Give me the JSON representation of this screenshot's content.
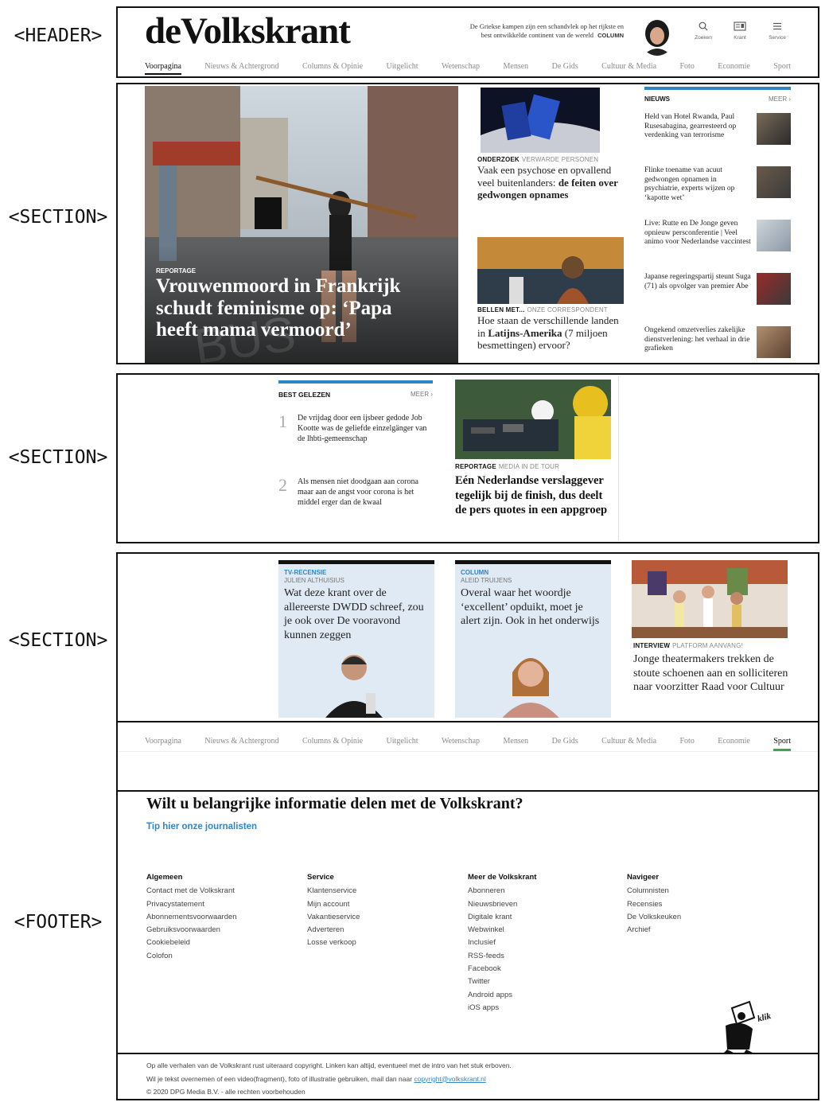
{
  "labels": {
    "header": "<HEADER>",
    "section1": "<SECTION>",
    "section2": "<SECTION>",
    "section3": "<SECTION>",
    "footer": "<FOOTER>"
  },
  "header": {
    "logo": "deVolkskrant",
    "teaser": "De Griekse kampen zijn een schandvlek op het rijkste en best ontwikkelde continent van de wereld",
    "teaser_tag": "COLUMN",
    "search_label": "Zoeken",
    "krant_label": "Krant",
    "service_label": "Service",
    "nav": [
      "Voorpagina",
      "Nieuws & Achtergrond",
      "Columns & Opinie",
      "Uitgelicht",
      "Wetenschap",
      "Mensen",
      "De Gids",
      "Cultuur & Media",
      "Foto",
      "Economie",
      "Sport"
    ],
    "active_nav": "Voorpagina"
  },
  "section1": {
    "hero_kicker": "REPORTAGE",
    "hero_title": "Vrouwenmoord in Frankrijk schudt feminisme op: ‘Papa heeft mama vermoord’",
    "story1_kicker": "ONDERZOEK",
    "story1_sub": "VERWARDE PERSONEN",
    "story1_title": "Vaak een psychose en opvallend veel buitenlanders:",
    "story1_bold": "de feiten over gedwongen opnames",
    "story2_kicker": "BELLEN MET...",
    "story2_sub": "ONZE CORRESPONDENT",
    "story2_title": "Hoe staan de verschillende landen in",
    "story2_bold": "Latijns-Amerika",
    "story2_rest": "(7 miljoen besmettingen) ervoor?",
    "news_label": "NIEUWS",
    "news_more": "MEER ›",
    "news_items": [
      "Held van Hotel Rwanda, Paul Rusesabagina, gearresteerd op verdenking van terrorisme",
      "Flinke toename van acuut gedwongen opnamen in psychiatrie, experts wijzen op ‘kapotte wet’",
      "Live: Rutte en De Jonge geven opnieuw persconferentie | Veel animo voor Nederlandse vaccintest",
      "Japanse regeringspartij steunt Suga (71) als opvolger van premier Abe",
      "Ongekend omzetverlies zakelijke dienstverlening: het verhaal in drie grafieken"
    ]
  },
  "section2": {
    "best_label": "BEST GELEZEN",
    "best_more": "MEER ›",
    "best_items": [
      {
        "num": "1",
        "text": "De vrijdag door een ijsbeer gedode Job Kootte was de geliefde einzelgänger van de lhbti-gemeenschap"
      },
      {
        "num": "2",
        "text": "Als mensen niet doodgaan aan corona maar aan de angst voor corona is het middel erger dan de kwaal"
      }
    ],
    "story_kicker": "REPORTAGE",
    "story_sub": "MEDIA IN DE TOUR",
    "story_title": "Eén Nederlandse verslaggever tegelijk bij de finish, dus deelt de pers quotes in een appgroep"
  },
  "section3": {
    "card1_kicker": "TV-RECENSIE",
    "card1_author": "JULIEN ALTHUISIUS",
    "card1_title": "Wat deze krant over de allereerste DWDD schreef, zou je ook over De vooravond kunnen zeggen",
    "card2_kicker": "COLUMN",
    "card2_author": "ALEID TRUIJENS",
    "card2_title": "Overal waar het woordje ‘excellent’ opduikt, moet je alert zijn. Ook in het onderwijs",
    "card3_kicker": "INTERVIEW",
    "card3_sub": "PLATFORM AANVANG!",
    "card3_title": "Jonge theatermakers trekken de stoute schoenen aan en solliciteren naar voorzitter Raad voor Cultuur"
  },
  "bottom_nav": {
    "items": [
      "Voorpagina",
      "Nieuws & Achtergrond",
      "Columns & Opinie",
      "Uitgelicht",
      "Wetenschap",
      "Mensen",
      "De Gids",
      "Cultuur & Media",
      "Foto",
      "Economie",
      "Sport"
    ],
    "active": "Sport"
  },
  "footer": {
    "headline": "Wilt u belangrijke informatie delen met de Volkskrant?",
    "tip_link": "Tip hier onze journalisten",
    "columns": [
      {
        "title": "Algemeen",
        "links": [
          "Contact met de Volkskrant",
          "Privacystatement",
          "Abonnementsvoorwaarden",
          "Gebruiksvoorwaarden",
          "Cookiebeleid",
          "Colofon"
        ]
      },
      {
        "title": "Service",
        "links": [
          "Klantenservice",
          "Mijn account",
          "Vakantieservice",
          "Adverteren",
          "Losse verkoop"
        ]
      },
      {
        "title": "Meer de Volkskrant",
        "links": [
          "Abonneren",
          "Nieuwsbrieven",
          "Digitale krant",
          "Webwinkel",
          "Inclusief",
          "RSS-feeds",
          "Facebook",
          "Twitter",
          "Android apps",
          "iOS apps"
        ]
      },
      {
        "title": "Navigeer",
        "links": [
          "Columnisten",
          "Recensies",
          "De Volkskeuken",
          "Archief"
        ]
      }
    ],
    "klik": "klik",
    "copyright_1": "Op alle verhalen van de Volkskrant rust uiteraard copyright. Linken kan altijd, eventueel met de intro van het stuk erboven.",
    "copyright_2": "Wil je tekst overnemen of een video(fragment), foto of illustratie gebruiken, mail dan naar",
    "copyright_email": "copyright@volkskrant.nl",
    "copyright_3": "© 2020 DPG Media B.V. - alle rechten voorbehouden"
  },
  "colors": {
    "accent_blue": "#2f86c5",
    "active_green": "#3aa55a",
    "card_bg": "#dfeaf4"
  }
}
